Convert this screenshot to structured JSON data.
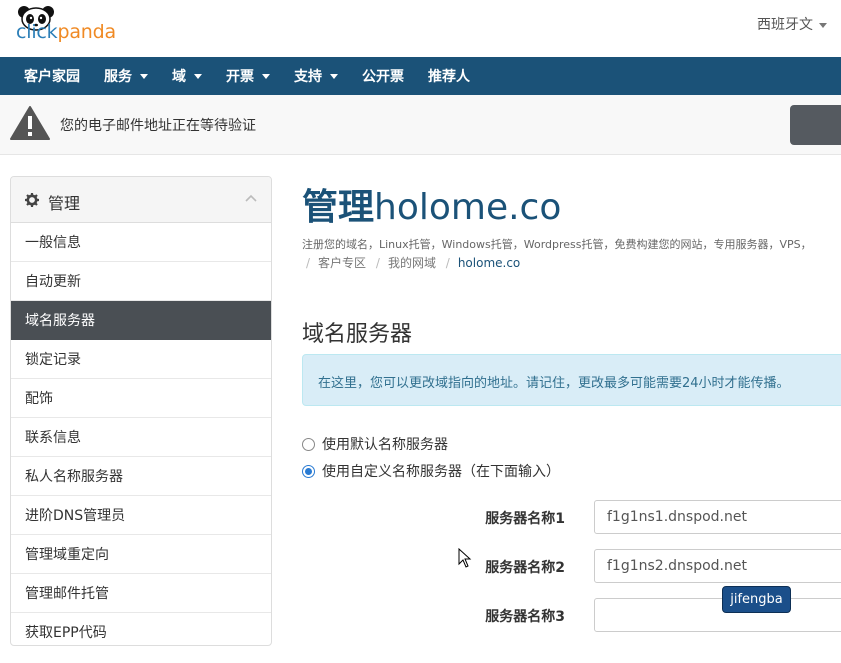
{
  "brand": {
    "part1": "click",
    "part2": "panda"
  },
  "language": {
    "label": "西班牙文"
  },
  "nav": {
    "items": [
      {
        "label": "客户家园",
        "dropdown": false
      },
      {
        "label": "服务",
        "dropdown": true
      },
      {
        "label": "域",
        "dropdown": true
      },
      {
        "label": "开票",
        "dropdown": true
      },
      {
        "label": "支持",
        "dropdown": true
      },
      {
        "label": "公开票",
        "dropdown": false
      },
      {
        "label": "推荐人",
        "dropdown": false
      }
    ]
  },
  "alert": {
    "message": "您的电子邮件地址正在等待验证"
  },
  "sidebar": {
    "title": "管理",
    "items": [
      {
        "label": "一般信息"
      },
      {
        "label": "自动更新"
      },
      {
        "label": "域名服务器",
        "active": true
      },
      {
        "label": "锁定记录"
      },
      {
        "label": "配饰"
      },
      {
        "label": "联系信息"
      },
      {
        "label": "私人名称服务器"
      },
      {
        "label": "进阶DNS管理员"
      },
      {
        "label": "管理域重定向"
      },
      {
        "label": "管理邮件托管"
      },
      {
        "label": "获取EPP代码"
      }
    ]
  },
  "main": {
    "title_prefix": "管理",
    "title_domain": "holome.co",
    "tagline": "注册您的域名，Linux托管，Windows托管，Wordpress托管，免费构建您的网站，专用服务器，VPS，",
    "breadcrumb": [
      "客户专区",
      "我的网域",
      "holome.co"
    ],
    "section_heading": "域名服务器",
    "info_text": "在这里，您可以更改域指向的地址。请记住，更改最多可能需要24小时才能传播。",
    "radio_default": "使用默认名称服务器",
    "radio_custom": "使用自定义名称服务器（在下面输入）",
    "nameservers": [
      {
        "label": "服务器名称1",
        "value": "f1g1ns1.dnspod.net"
      },
      {
        "label": "服务器名称2",
        "value": "f1g1ns2.dnspod.net"
      },
      {
        "label": "服务器名称3",
        "value": ""
      }
    ]
  },
  "watermark": "jifengba",
  "colors": {
    "primary": "#1b5278",
    "active_side": "#4a4f54",
    "info_bg": "#d9edf7",
    "brand_orange": "#f08a24"
  }
}
